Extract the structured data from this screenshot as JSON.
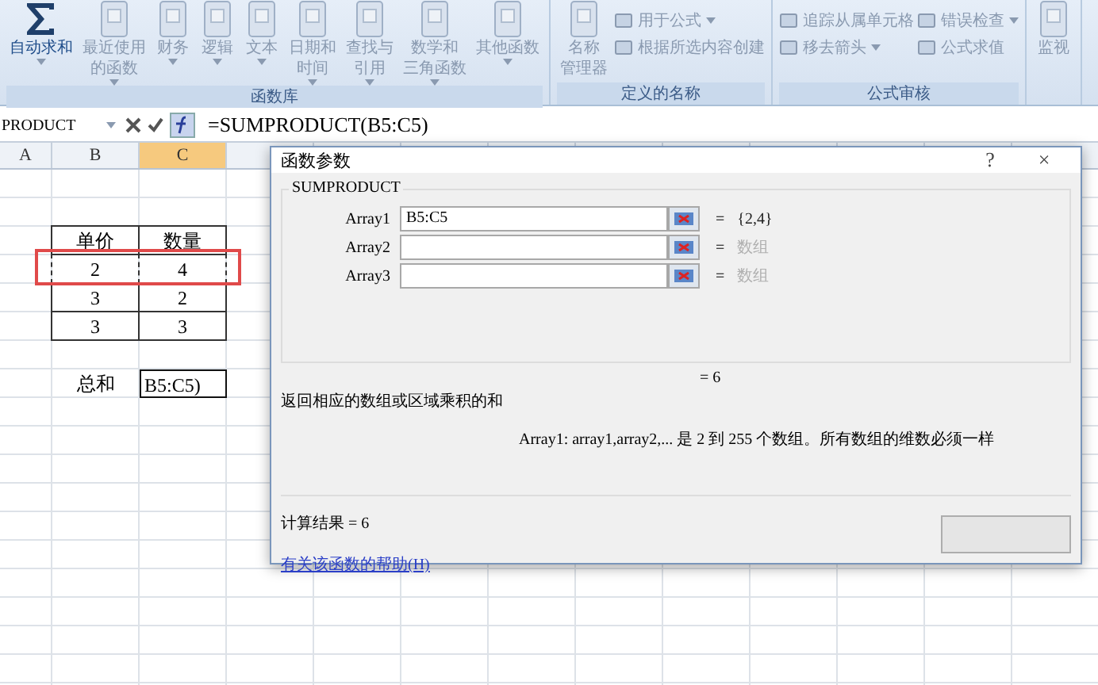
{
  "ribbon": {
    "groups": [
      {
        "label": "函数库",
        "buttons": [
          {
            "kind": "sigma",
            "lines": [
              "自动求和"
            ],
            "dropdown": true,
            "disabled": false
          },
          {
            "kind": "book",
            "lines": [
              "最近使用",
              "的函数"
            ],
            "dropdown": true,
            "disabled": true
          },
          {
            "kind": "book",
            "lines": [
              "财务"
            ],
            "dropdown": true,
            "disabled": true
          },
          {
            "kind": "book",
            "lines": [
              "逻辑"
            ],
            "dropdown": true,
            "disabled": true
          },
          {
            "kind": "book",
            "lines": [
              "文本"
            ],
            "dropdown": true,
            "disabled": true
          },
          {
            "kind": "book",
            "lines": [
              "日期和",
              "时间"
            ],
            "dropdown": true,
            "disabled": true
          },
          {
            "kind": "book",
            "lines": [
              "查找与",
              "引用"
            ],
            "dropdown": true,
            "disabled": true
          },
          {
            "kind": "book",
            "lines": [
              "数学和",
              "三角函数"
            ],
            "dropdown": true,
            "disabled": true
          },
          {
            "kind": "book",
            "lines": [
              "其他函数"
            ],
            "dropdown": true,
            "disabled": true
          }
        ]
      },
      {
        "label": "定义的名称",
        "buttons": [
          {
            "kind": "book",
            "lines": [
              "名称",
              "管理器"
            ],
            "dropdown": false,
            "disabled": true
          },
          {
            "kind": "small",
            "lines": [
              "用于公式"
            ],
            "dropdown": true,
            "disabled": true
          },
          {
            "kind": "small",
            "lines": [
              "根据所选内容创建"
            ],
            "dropdown": false,
            "disabled": true
          }
        ]
      },
      {
        "label": "公式审核",
        "buttons": [
          {
            "kind": "small",
            "lines": [
              "追踪从属单元格"
            ],
            "dropdown": false,
            "disabled": true
          },
          {
            "kind": "small",
            "lines": [
              "移去箭头"
            ],
            "dropdown": true,
            "disabled": true
          },
          {
            "kind": "small",
            "lines": [
              "错误检查"
            ],
            "dropdown": true,
            "disabled": true
          },
          {
            "kind": "small",
            "lines": [
              "公式求值"
            ],
            "dropdown": false,
            "disabled": true
          }
        ]
      },
      {
        "buttons": [
          {
            "kind": "book",
            "lines": [
              "监视"
            ],
            "dropdown": false,
            "disabled": true
          }
        ]
      }
    ]
  },
  "formula_bar": {
    "name_box": "PRODUCT",
    "formula": "=SUMPRODUCT(B5:C5)"
  },
  "sheet": {
    "columns": [
      {
        "label": "A",
        "selected": false
      },
      {
        "label": "B",
        "selected": false
      },
      {
        "label": "C",
        "selected": true
      }
    ],
    "table": {
      "header": [
        "单价",
        "数量"
      ],
      "rows": [
        {
          "cells": [
            "2",
            "4"
          ],
          "copied": true
        },
        {
          "cells": [
            "3",
            "2"
          ],
          "copied": false
        },
        {
          "cells": [
            "3",
            "3"
          ],
          "copied": false
        }
      ]
    },
    "sum": {
      "label": "总和",
      "value": "B5:C5)"
    }
  },
  "dialog": {
    "title": "函数参数",
    "help": "?",
    "close": "×",
    "function": "SUMPRODUCT",
    "args": [
      {
        "label": "Array1",
        "value": "B5:C5",
        "equals": "=",
        "result": "{2,4}",
        "empty": false
      },
      {
        "label": "Array2",
        "equals": "=",
        "result": "数组",
        "empty": true
      },
      {
        "label": "Array3",
        "equals": "=",
        "result": "数组",
        "empty": true
      }
    ],
    "total": "= 6",
    "description": "返回相应的数组或区域乘积的和",
    "arg_help": "Array1:  array1,array2,... 是 2 到 255 个数组。所有数组的维数必须一样",
    "result": "计算结果 =  6",
    "help_link": "有关该函数的帮助(H)"
  }
}
